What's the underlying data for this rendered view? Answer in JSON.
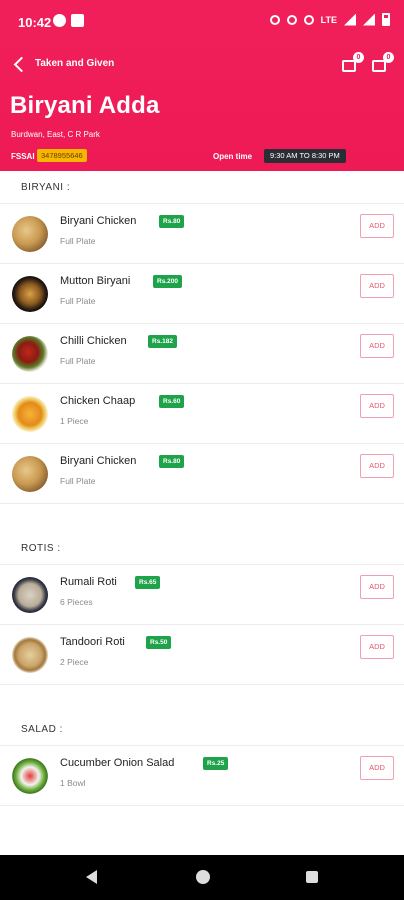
{
  "status_bar": {
    "time": "10:42",
    "network": "LTE"
  },
  "header": {
    "nav_title": "Taken and Given",
    "chat_badge": "0",
    "cart_badge": "0",
    "restaurant_name": "Biryani Adda",
    "address": "Burdwan, East, C R Park",
    "fssai_label": "FSSAI",
    "fssai_value": "3478955646",
    "open_label": "Open time",
    "open_value": "9:30 AM TO 8:30 PM"
  },
  "colors": {
    "brand": "#ee1a55",
    "price_badge": "#1fa34a",
    "fssai_badge": "#f5b700"
  },
  "sections": [
    {
      "title": "BIRYANI :",
      "items": [
        {
          "name": "Biryani Chicken",
          "price": "Rs.80",
          "desc": "Full Plate",
          "add": "ADD",
          "icon": "biryani-chicken-image"
        },
        {
          "name": "Mutton Biryani",
          "price": "Rs.200",
          "desc": "Full Plate",
          "add": "ADD",
          "icon": "mutton-biryani-image"
        },
        {
          "name": "Chilli Chicken",
          "price": "Rs.182",
          "desc": "Full Plate",
          "add": "ADD",
          "icon": "chilli-chicken-image"
        },
        {
          "name": "Chicken Chaap",
          "price": "Rs.60",
          "desc": "1 Piece",
          "add": "ADD",
          "icon": "chicken-chaap-image"
        },
        {
          "name": "Biryani Chicken",
          "price": "Rs.80",
          "desc": "Full Plate",
          "add": "ADD",
          "icon": "biryani-chicken-image"
        }
      ]
    },
    {
      "title": "ROTIS :",
      "items": [
        {
          "name": "Rumali Roti",
          "price": "Rs.65",
          "desc": "6 Pieces",
          "add": "ADD",
          "icon": "rumali-roti-image"
        },
        {
          "name": "Tandoori Roti",
          "price": "Rs.50",
          "desc": "2 Piece",
          "add": "ADD",
          "icon": "tandoori-roti-image"
        }
      ]
    },
    {
      "title": "SALAD :",
      "items": [
        {
          "name": "Cucumber Onion Salad",
          "price": "Rs.25",
          "desc": "1 Bowl",
          "add": "ADD",
          "icon": "salad-image"
        }
      ]
    }
  ]
}
